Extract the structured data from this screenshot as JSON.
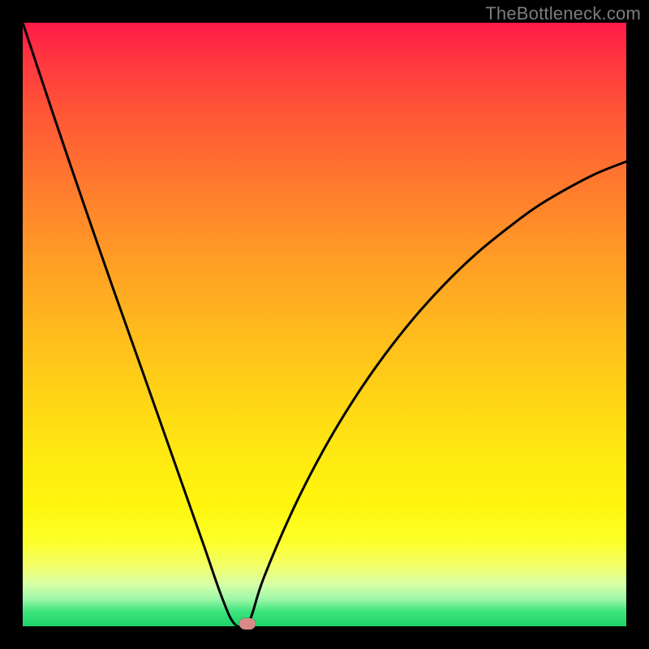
{
  "watermark": "TheBottleneck.com",
  "chart_data": {
    "type": "line",
    "title": "",
    "xlabel": "",
    "ylabel": "",
    "xlim": [
      0,
      100
    ],
    "ylim": [
      0,
      100
    ],
    "x": [
      0,
      5,
      10,
      15,
      20,
      25,
      30,
      33,
      35,
      37,
      38,
      40,
      45,
      50,
      55,
      60,
      65,
      70,
      75,
      80,
      85,
      90,
      95,
      100
    ],
    "values": [
      100,
      85,
      70.3,
      55.9,
      41.8,
      27.6,
      13.4,
      4.8,
      0.5,
      0,
      2,
      8.2,
      19.8,
      29.5,
      37.8,
      45,
      51.3,
      56.8,
      61.6,
      65.7,
      69.4,
      72.4,
      75,
      77
    ],
    "marker": {
      "x": 37.2,
      "y": 0.4
    },
    "gradient_stops": [
      {
        "pos": 0.0,
        "color": "#ff1a49"
      },
      {
        "pos": 0.5,
        "color": "#ffb81e"
      },
      {
        "pos": 0.8,
        "color": "#fff60e"
      },
      {
        "pos": 0.97,
        "color": "#3fe47c"
      },
      {
        "pos": 1.0,
        "color": "#1dd36b"
      }
    ]
  }
}
